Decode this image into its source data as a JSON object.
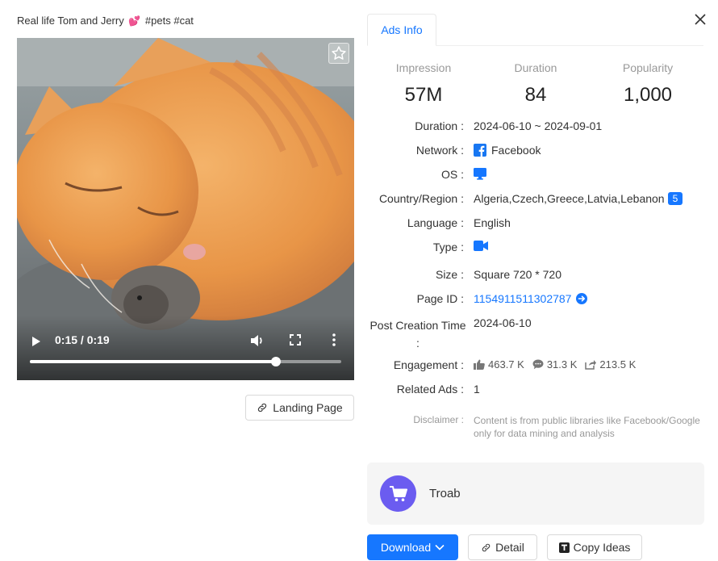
{
  "post": {
    "title_prefix": "Real life Tom and Jerry",
    "title_emoji": "💕",
    "title_tags": "#pets #cat"
  },
  "video": {
    "time": "0:15 / 0:19",
    "progress": 0.79
  },
  "landing_page_label": "Landing Page",
  "tabs": [
    {
      "label": "Ads Info"
    }
  ],
  "stats": [
    {
      "label": "Impression",
      "value": "57M"
    },
    {
      "label": "Duration",
      "value": "84"
    },
    {
      "label": "Popularity",
      "value": "1,000"
    }
  ],
  "details": {
    "duration_label": "Duration :",
    "duration_value": "2024-06-10 ~ 2024-09-01",
    "network_label": "Network :",
    "network_value": "Facebook",
    "os_label": "OS :",
    "os_icon": "desktop-icon",
    "country_label": "Country/Region :",
    "country_value": "Algeria,Czech,Greece,Latvia,Lebanon",
    "country_badge": "5",
    "language_label": "Language :",
    "language_value": "English",
    "type_label": "Type :",
    "type_icon": "video-camera-icon",
    "size_label": "Size :",
    "size_value": "Square 720 * 720",
    "pageid_label": "Page ID :",
    "pageid_value": "1154911511302787",
    "post_creation_label": "Post Creation Time",
    "post_creation_colon": ":",
    "post_creation_value": "2024-06-10",
    "engagement_label": "Engagement :",
    "likes": "463.7 K",
    "comments": "31.3 K",
    "shares": "213.5 K",
    "related_label": "Related Ads :",
    "related_value": "1"
  },
  "disclaimer": {
    "label": "Disclaimer :",
    "text": "Content is from public libraries like Facebook/Google only for data mining and analysis"
  },
  "advertiser": {
    "name": "Troab"
  },
  "actions": {
    "download": "Download",
    "detail": "Detail",
    "copy_ideas": "Copy Ideas"
  },
  "colors": {
    "accent": "#1677ff",
    "avatar": "#6b5cf0",
    "facebook": "#1877f2"
  }
}
